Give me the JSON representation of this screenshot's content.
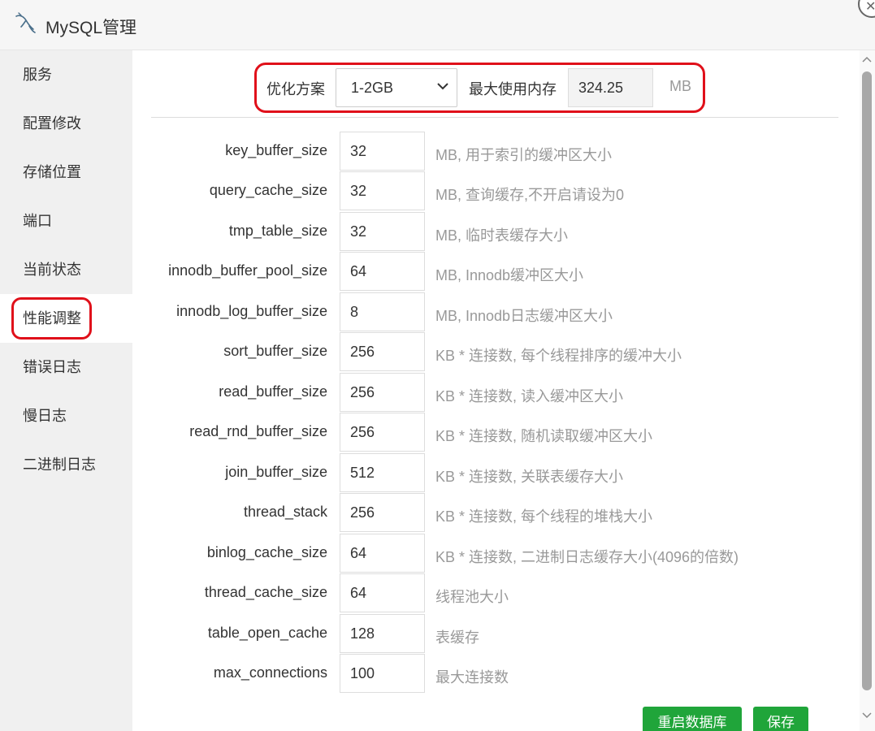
{
  "window": {
    "title": "MySQL管理"
  },
  "sidebar": {
    "items": [
      {
        "label": "服务"
      },
      {
        "label": "配置修改"
      },
      {
        "label": "存储位置"
      },
      {
        "label": "端口"
      },
      {
        "label": "当前状态"
      },
      {
        "label": "性能调整"
      },
      {
        "label": "错误日志"
      },
      {
        "label": "慢日志"
      },
      {
        "label": "二进制日志"
      }
    ],
    "active": "性能调整"
  },
  "plan": {
    "label": "优化方案",
    "selected": "1-2GB",
    "max_mem_label": "最大使用内存",
    "max_mem_value": "324.25",
    "max_mem_unit": "MB"
  },
  "params": [
    {
      "name": "key_buffer_size",
      "value": "32",
      "desc": "MB, 用于索引的缓冲区大小"
    },
    {
      "name": "query_cache_size",
      "value": "32",
      "desc": "MB, 查询缓存,不开启请设为0"
    },
    {
      "name": "tmp_table_size",
      "value": "32",
      "desc": "MB, 临时表缓存大小"
    },
    {
      "name": "innodb_buffer_pool_size",
      "value": "64",
      "desc": "MB, Innodb缓冲区大小"
    },
    {
      "name": "innodb_log_buffer_size",
      "value": "8",
      "desc": "MB, Innodb日志缓冲区大小"
    },
    {
      "name": "sort_buffer_size",
      "value": "256",
      "desc": "KB * 连接数, 每个线程排序的缓冲大小"
    },
    {
      "name": "read_buffer_size",
      "value": "256",
      "desc": "KB * 连接数, 读入缓冲区大小"
    },
    {
      "name": "read_rnd_buffer_size",
      "value": "256",
      "desc": "KB * 连接数, 随机读取缓冲区大小"
    },
    {
      "name": "join_buffer_size",
      "value": "512",
      "desc": "KB * 连接数, 关联表缓存大小"
    },
    {
      "name": "thread_stack",
      "value": "256",
      "desc": "KB * 连接数, 每个线程的堆栈大小"
    },
    {
      "name": "binlog_cache_size",
      "value": "64",
      "desc": "KB * 连接数, 二进制日志缓存大小(4096的倍数)"
    },
    {
      "name": "thread_cache_size",
      "value": "64",
      "desc": "线程池大小"
    },
    {
      "name": "table_open_cache",
      "value": "128",
      "desc": "表缓存"
    },
    {
      "name": "max_connections",
      "value": "100",
      "desc": "最大连接数"
    }
  ],
  "buttons": {
    "restart": "重启数据库",
    "save": "保存"
  },
  "icons": {
    "app": "mysql-dolphin-icon",
    "close": "close-icon"
  },
  "colors": {
    "accent": "#20a53a",
    "highlight": "#e0101a"
  }
}
